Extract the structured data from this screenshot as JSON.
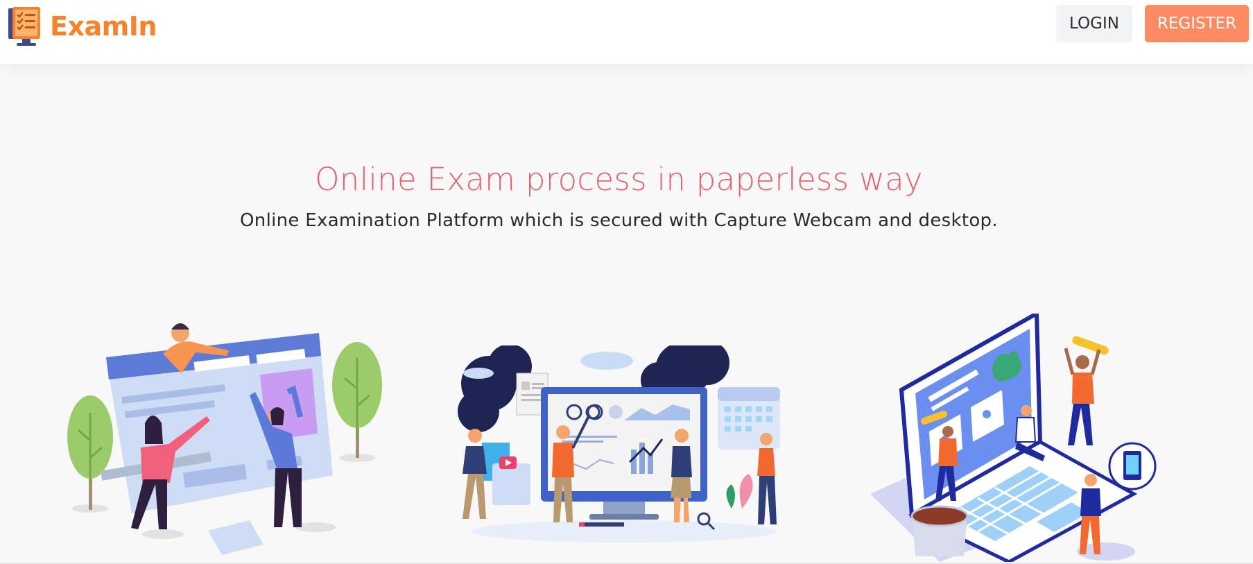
{
  "brand": {
    "name": "ExamIn",
    "icon": "exam-checklist-monitor-icon"
  },
  "nav": {
    "login_label": "LOGIN",
    "register_label": "REGISTER"
  },
  "hero": {
    "title": "Online Exam process in paperless way",
    "subtitle": "Online Examination Platform which is secured with Capture Webcam and desktop."
  },
  "illustrations": [
    {
      "name": "collaborative-webpage-design-illustration"
    },
    {
      "name": "data-analytics-dashboard-illustration"
    },
    {
      "name": "laptop-teamwork-illustration"
    }
  ],
  "colors": {
    "brand": "#f7822b",
    "register_bg": "#fc8a62",
    "hero_title": "#e4606b",
    "login_bg": "#f3f4f6"
  }
}
